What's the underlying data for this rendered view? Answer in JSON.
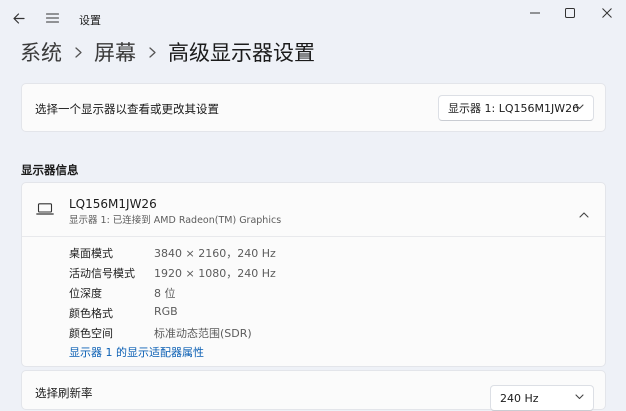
{
  "window": {
    "title": "设置"
  },
  "breadcrumb": {
    "items": [
      "系统",
      "屏幕"
    ],
    "current": "高级显示器设置"
  },
  "display_select": {
    "label": "选择一个显示器以查看或更改其设置",
    "selected": "显示器 1: LQ156M1JW26"
  },
  "display_info": {
    "section_title": "显示器信息",
    "monitor_name": "LQ156M1JW26",
    "monitor_sub": "显示器 1: 已连接到 AMD Radeon(TM) Graphics",
    "props": [
      {
        "label": "桌面模式",
        "value": "3840 × 2160，240 Hz"
      },
      {
        "label": "活动信号模式",
        "value": "1920 × 1080，240 Hz"
      },
      {
        "label": "位深度",
        "value": "8 位"
      },
      {
        "label": "颜色格式",
        "value": "RGB"
      },
      {
        "label": "颜色空间",
        "value": "标准动态范围(SDR)"
      }
    ],
    "adapter_link": "显示器 1 的显示适配器属性"
  },
  "refresh_rate": {
    "label": "选择刷新率",
    "selected": "240 Hz"
  },
  "icons": {
    "back": "back-arrow-icon",
    "menu": "hamburger-menu-icon",
    "minimize": "minimize-icon",
    "maximize": "maximize-icon",
    "close": "close-icon",
    "chevron_right": "chevron-right-icon",
    "chevron_down": "chevron-down-icon",
    "chevron_up": "chevron-up-icon",
    "monitor": "laptop-monitor-icon"
  },
  "colors": {
    "background": "#eef1f7",
    "card": "#fbfbfb",
    "link": "#0a5fb4"
  }
}
